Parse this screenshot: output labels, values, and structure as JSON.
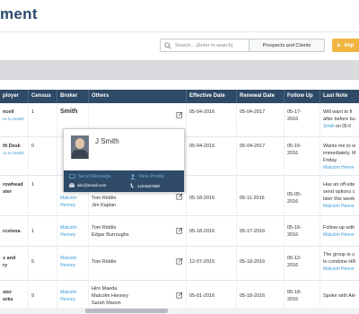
{
  "header": {
    "title": "ment"
  },
  "toolbar": {
    "search_placeholder": "Search... (Enter to search)",
    "prospects_label": "Prospects and Clients",
    "import_label": "Imp"
  },
  "columns": [
    "ployer",
    "Census",
    "Broker",
    "Others",
    "Effective Date",
    "Renewal Date",
    "Follow Up",
    "Last Note"
  ],
  "rows": [
    {
      "employer": "ncell",
      "employer_sub": "ns to Health",
      "census": "1",
      "broker": "Smith",
      "broker_sub": "",
      "others": [
        "",
        ""
      ],
      "effective": "05-04-2016",
      "renewal": "05-04-2017",
      "followup": [
        "05-17-",
        "2016"
      ],
      "note": [
        "Will want to fi",
        "after before bu"
      ],
      "note_link": "Smith",
      "note_date": "on 05-0"
    },
    {
      "employer": "ift Desk",
      "employer_sub": "ns to Health",
      "census": "0",
      "broker": "",
      "broker_sub": "",
      "others": [
        "",
        ""
      ],
      "effective": "05-04-2016",
      "renewal": "05-04-2017",
      "followup": [
        "05-16-",
        "2016"
      ],
      "note": [
        "Wants me to w",
        "immediately. M",
        "Friday"
      ],
      "note_link": "Malcolm Henne",
      "note_date": ""
    },
    {
      "employer": "rowhead",
      "employer2": "ster",
      "census": "1",
      "broker": "Malcolm",
      "broker2": "Henney",
      "others": [
        "Tom Riddle",
        "Jim Kaplan"
      ],
      "effective": "05-18-2016",
      "renewal": "05-11-2016",
      "followup": [
        "05-05-",
        "2016"
      ],
      "note": [
        "Has an off-site",
        "send options c",
        "later this week"
      ],
      "note_link": "Malcolm Henne",
      "note_date": ""
    },
    {
      "employer": "rcelona",
      "census": "1",
      "broker": "Malcolm",
      "broker2": "Henney",
      "others": [
        "Tom Riddle",
        "Edgar Burroughs"
      ],
      "effective": "05-18-2016",
      "renewal": "05-17-2016",
      "followup": [
        "05-16-",
        "2016"
      ],
      "note": [
        "Follow-up with"
      ],
      "note_link": "Malcolm Henne",
      "note_date": ""
    },
    {
      "employer": "s and",
      "employer2": "ry",
      "census": "5",
      "broker": "Malcolm",
      "broker2": "Henney",
      "others": [
        "Tom Riddle",
        ""
      ],
      "effective": "12-07-2015",
      "renewal": "05-18-2016",
      "followup": [
        "05-12-",
        "2016"
      ],
      "note": [
        "The group is u",
        "to combine HR"
      ],
      "note_link": "Malcolm Henne",
      "note_date": ""
    },
    {
      "employer": "ster",
      "employer2": "orks",
      "census": "9",
      "broker": "Malcolm",
      "broker2": "Henney",
      "others": [
        "Hiro Maeda",
        "Malcolm Henney",
        "Sarah Mason"
      ],
      "effective": "05-01-2016",
      "renewal": "05-18-2016",
      "followup": [
        "05-18-",
        "2016"
      ],
      "note": [
        "Spoke with Ale"
      ],
      "note_link": "",
      "note_date": ""
    }
  ],
  "popup": {
    "name": "J Smith",
    "send_message": "Send Message",
    "view_profile": "View Profile",
    "email": "abc@email.com",
    "phone": "1234567890"
  },
  "colors": {
    "header": "#2e4a66",
    "link": "#3d9bd6",
    "import": "#f0b541",
    "title": "#2a4a6b"
  }
}
